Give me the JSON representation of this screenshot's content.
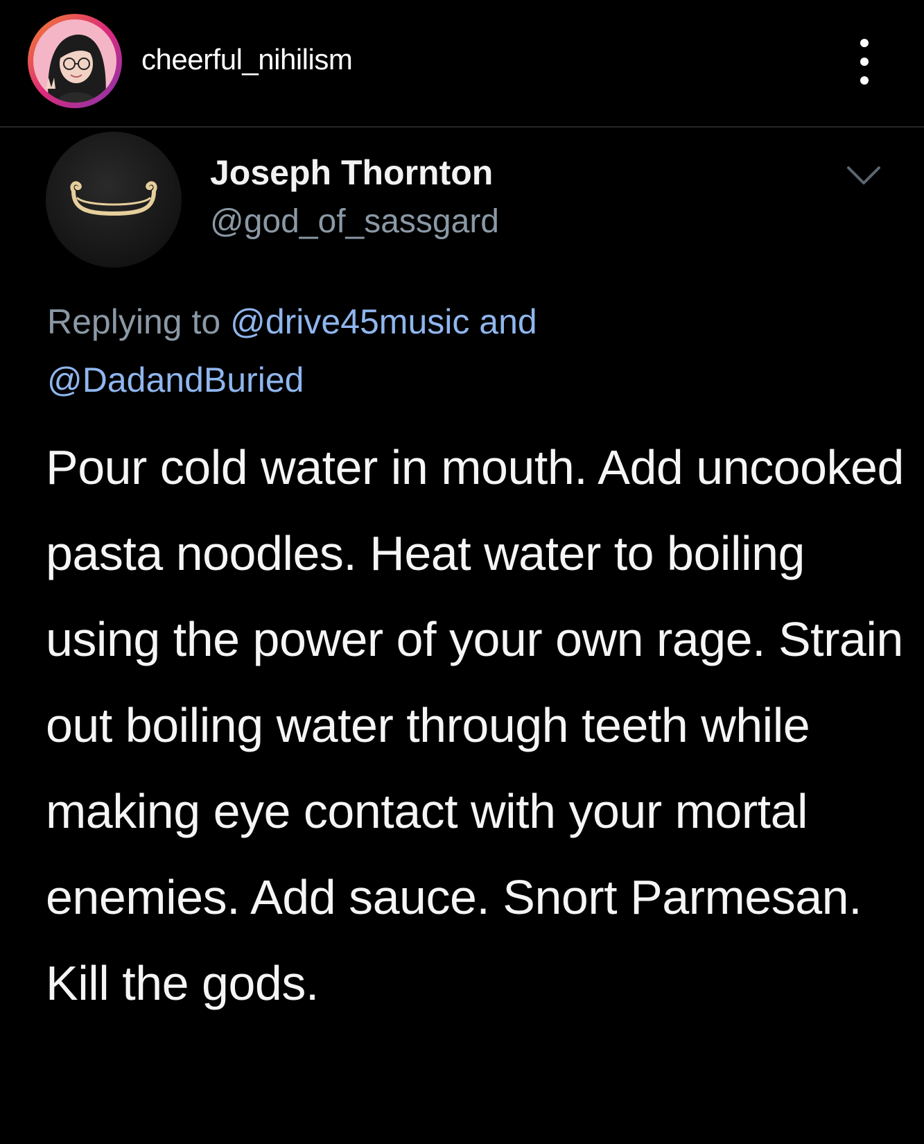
{
  "instagram_header": {
    "username": "cheerful_nihilism",
    "more_icon": "vertical-ellipsis-icon"
  },
  "tweet": {
    "author_name": "Joseph Thornton",
    "author_handle": "@god_of_sassgard",
    "menu_icon": "chevron-down-icon",
    "reply_prefix": "Replying to",
    "reply_mentions": [
      "@drive45music",
      "@DadandBuried"
    ],
    "reply_joiner": "and",
    "text": "Pour cold water in mouth. Add uncooked pasta noodles. Heat water to boiling using the power of your own rage. Strain out boiling water through teeth while making eye contact with your mortal enemies. Add sauce. Snort Parmesan. Kill the gods."
  },
  "colors": {
    "background": "#000000",
    "handle_gray": "#8b98a5",
    "mention_blue": "#8fb6ee",
    "divider": "#262626"
  }
}
